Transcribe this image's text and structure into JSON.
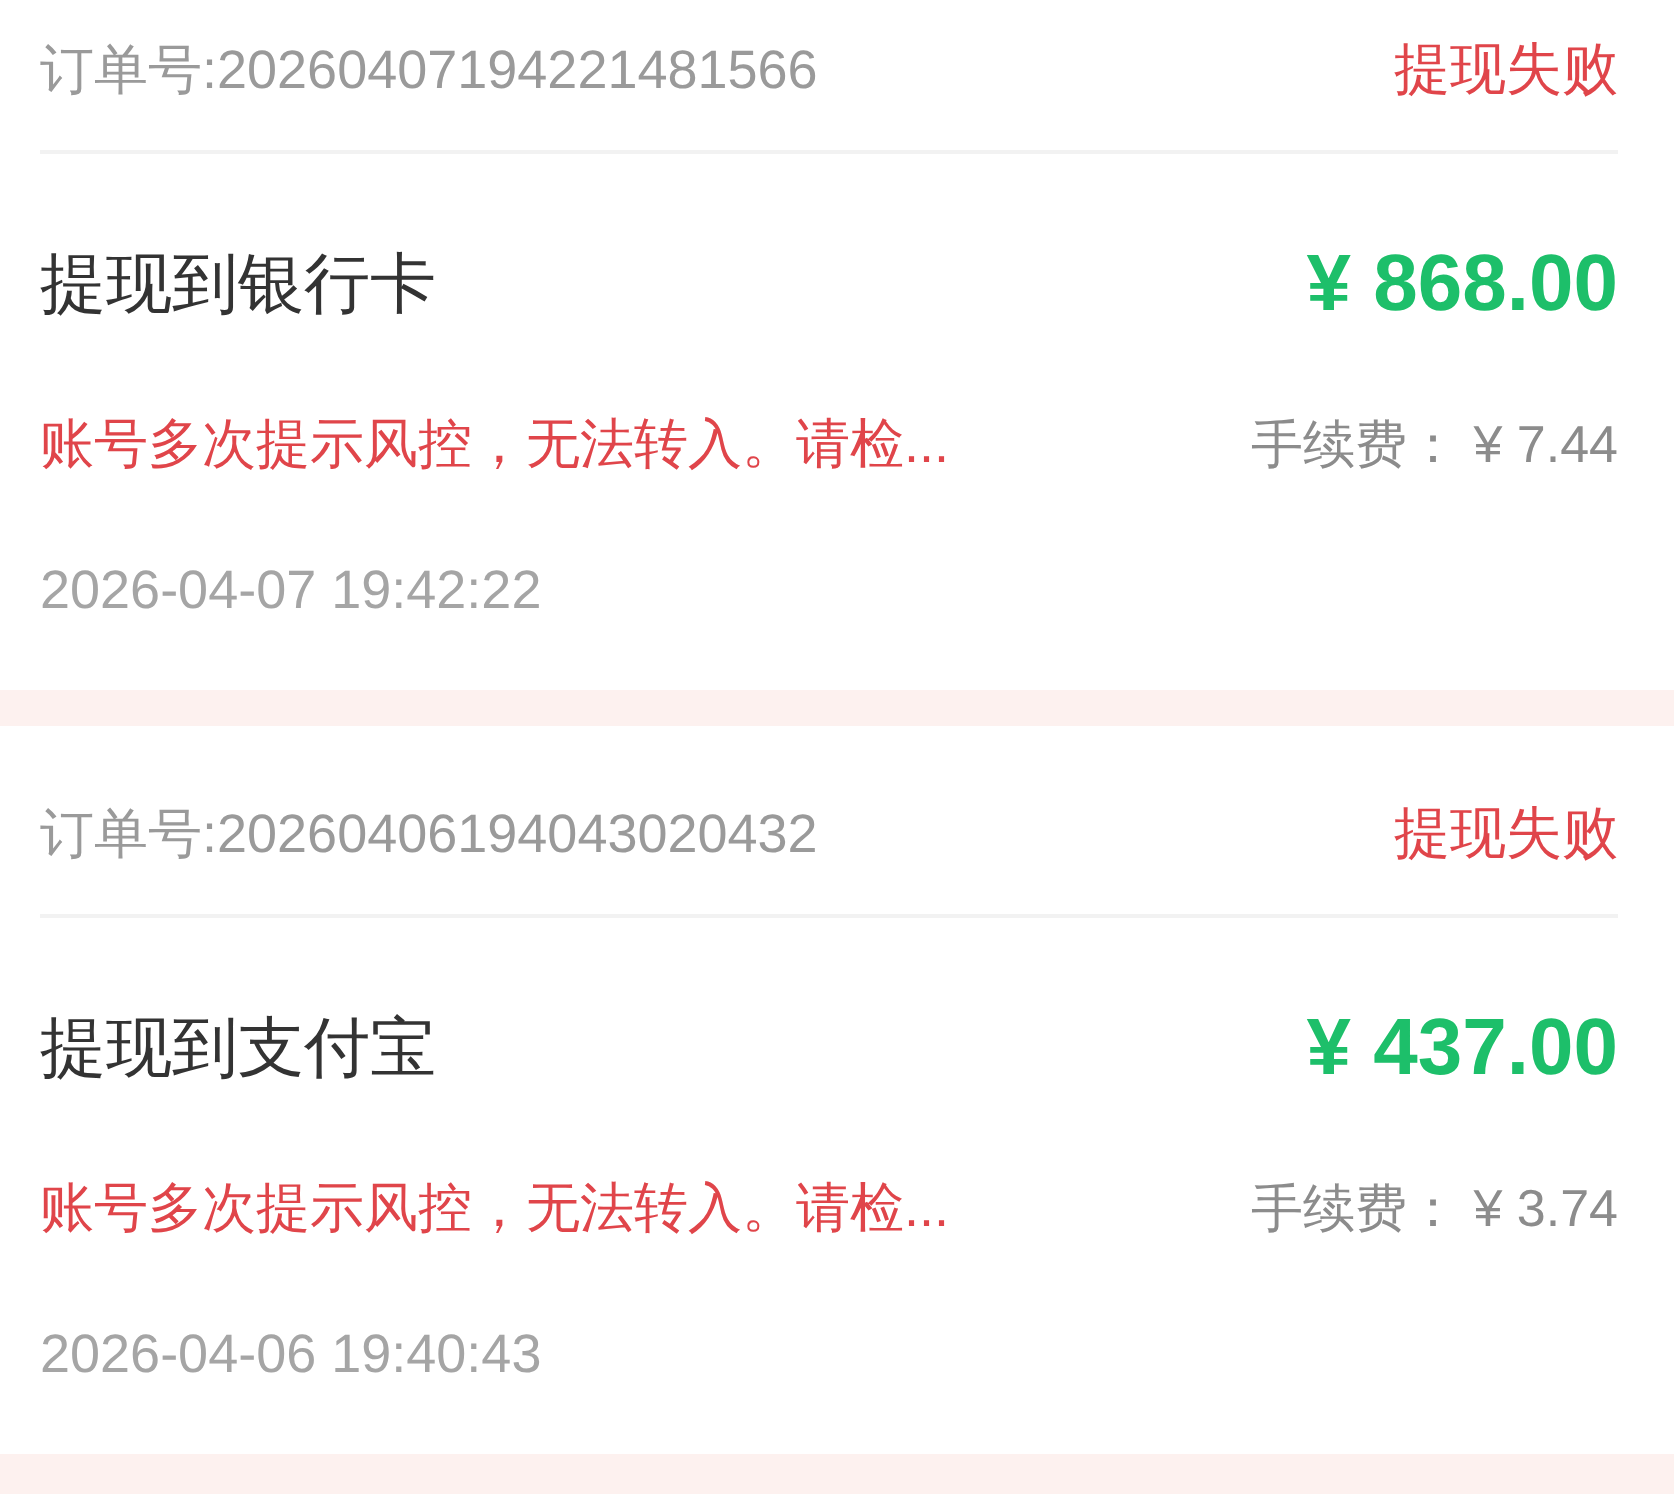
{
  "orders": [
    {
      "order_number": "订单号:20260407194221481566",
      "status": "提现失败",
      "title": "提现到银行卡",
      "amount": "¥ 868.00",
      "message": "账号多次提示风控，无法转入。请检...",
      "fee": "手续费： ¥ 7.44",
      "time": "2026-04-07 19:42:22"
    },
    {
      "order_number": "订单号:20260406194043020432",
      "status": "提现失败",
      "title": "提现到支付宝",
      "amount": "¥ 437.00",
      "message": "账号多次提示风控，无法转入。请检...",
      "fee": "手续费： ¥ 3.74",
      "time": "2026-04-06 19:40:43"
    }
  ]
}
